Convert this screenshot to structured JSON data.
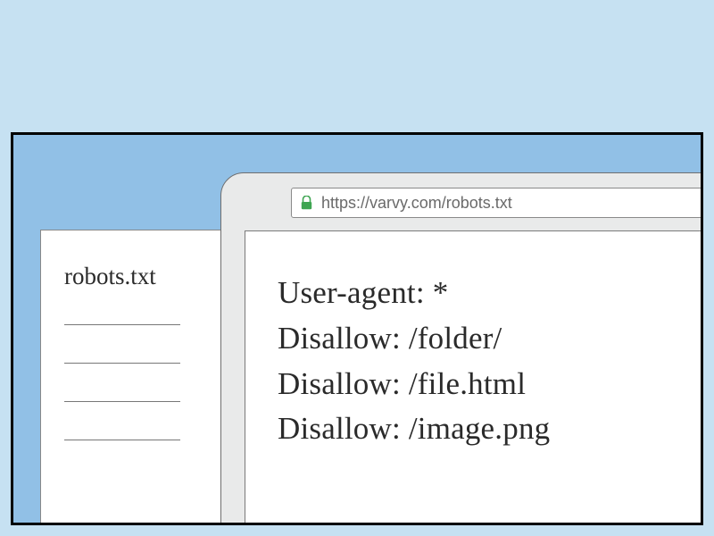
{
  "paper": {
    "title": "robots.txt"
  },
  "browser": {
    "url": "https://varvy.com/robots.txt"
  },
  "robots": {
    "lines": [
      "User-agent: *",
      "Disallow: /folder/",
      "Disallow: /file.html",
      "Disallow: /image.png"
    ]
  },
  "colors": {
    "lock": "#3fa552"
  }
}
